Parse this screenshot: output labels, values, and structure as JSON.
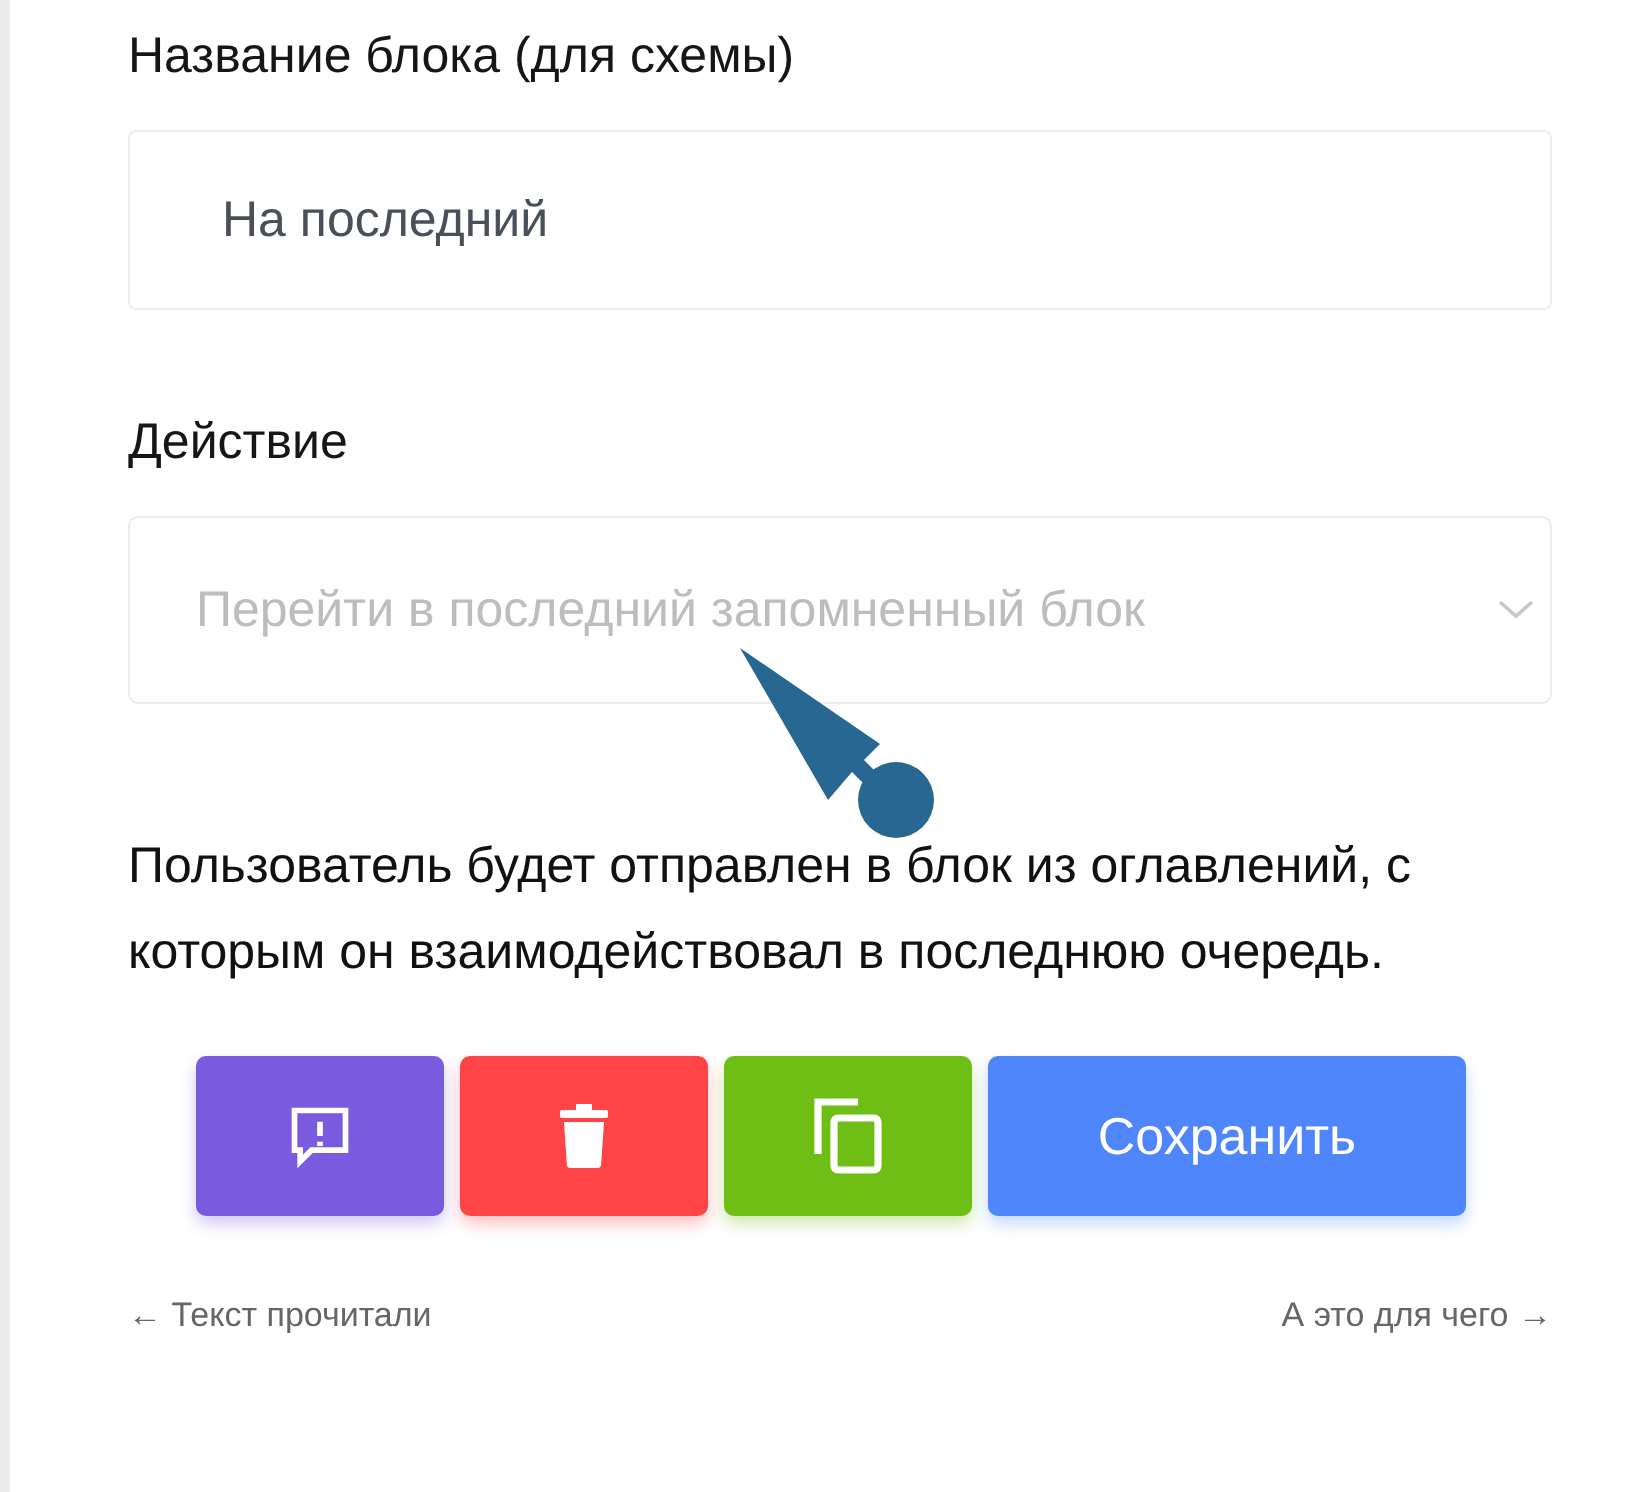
{
  "name_field": {
    "label": "Название блока (для схемы)",
    "value": "На последний"
  },
  "action_field": {
    "label": "Действие",
    "placeholder": "Перейти в последний запомненный блок"
  },
  "description": "Пользователь будет отправлен в блок из оглавлений, с которым он взаимодействовал в последнюю очередь.",
  "buttons": [
    {
      "kind": "feedback",
      "color": "#7a5ade"
    },
    {
      "kind": "delete",
      "color": "#fe4447"
    },
    {
      "kind": "copy",
      "color": "#6ebe16"
    },
    {
      "kind": "save",
      "color": "#4f86fc",
      "label": "Сохранить"
    }
  ],
  "footer": {
    "prev": "← Текст прочитали",
    "next": "А это для чего →"
  }
}
